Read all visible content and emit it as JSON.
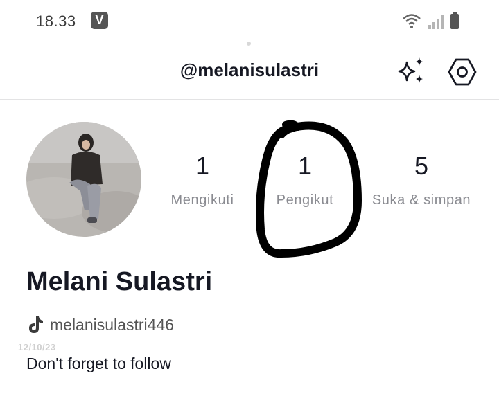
{
  "status_bar": {
    "time": "18.33",
    "badge": "V",
    "icons": [
      "wifi-icon",
      "signal-icon",
      "battery-icon"
    ]
  },
  "header": {
    "title": "@melanisulastri",
    "icons": [
      "sparkle-icon",
      "settings-icon"
    ]
  },
  "profile": {
    "display_name": "Melani Sulastri",
    "username": "melanisulastri446",
    "bio": "Don't forget to follow",
    "watermark": "12/10/23"
  },
  "stats": [
    {
      "value": "1",
      "label": "Mengikuti"
    },
    {
      "value": "1",
      "label": "Pengikut"
    },
    {
      "value": "5",
      "label": "Suka & simpan"
    }
  ],
  "colors": {
    "text_primary": "#161823",
    "text_secondary": "#8a8b91",
    "annotation": "#000000"
  }
}
